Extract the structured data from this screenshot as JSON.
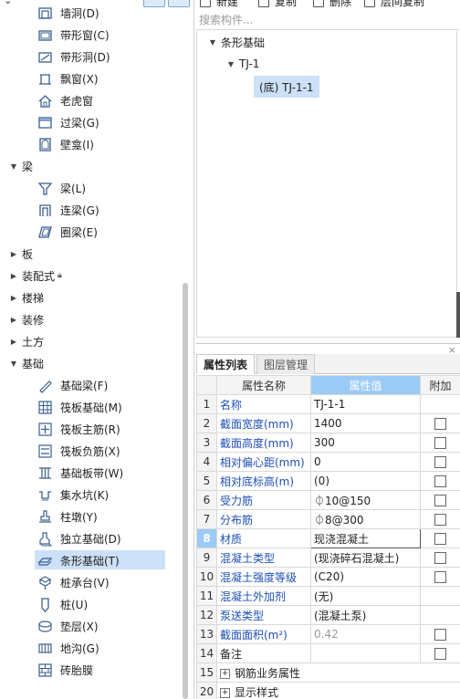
{
  "left_tree": {
    "rows": [
      {
        "type": "item",
        "icon": "wall-opening-icon",
        "label": "墙洞(D)"
      },
      {
        "type": "item",
        "icon": "strip-window-icon",
        "label": "带形窗(C)"
      },
      {
        "type": "item",
        "icon": "strip-opening-icon",
        "label": "带形洞(D)"
      },
      {
        "type": "item",
        "icon": "bay-window-icon",
        "label": "飘窗(X)"
      },
      {
        "type": "item",
        "icon": "dormer-window-icon",
        "label": "老虎窗"
      },
      {
        "type": "item",
        "icon": "lintel-icon",
        "label": "过梁(G)"
      },
      {
        "type": "item",
        "icon": "niche-icon",
        "label": "壁龛(I)"
      },
      {
        "type": "cat",
        "expanded": true,
        "label": "梁"
      },
      {
        "type": "item",
        "icon": "beam-icon",
        "label": "梁(L)"
      },
      {
        "type": "item",
        "icon": "coupling-beam-icon",
        "label": "连梁(G)"
      },
      {
        "type": "item",
        "icon": "ring-beam-icon",
        "label": "圈梁(E)"
      },
      {
        "type": "cat",
        "expanded": false,
        "label": "板"
      },
      {
        "type": "cat",
        "expanded": false,
        "label": "装配式",
        "lock": true
      },
      {
        "type": "cat",
        "expanded": false,
        "label": "楼梯"
      },
      {
        "type": "cat",
        "expanded": false,
        "label": "装修"
      },
      {
        "type": "cat",
        "expanded": false,
        "label": "土方"
      },
      {
        "type": "cat",
        "expanded": true,
        "label": "基础"
      },
      {
        "type": "item",
        "icon": "foundation-beam-icon",
        "label": "基础梁(F)"
      },
      {
        "type": "item",
        "icon": "raft-foundation-icon",
        "label": "筏板基础(M)"
      },
      {
        "type": "item",
        "icon": "raft-main-rebar-icon",
        "label": "筏板主筋(R)"
      },
      {
        "type": "item",
        "icon": "raft-negative-rebar-icon",
        "label": "筏板负筋(X)"
      },
      {
        "type": "item",
        "icon": "foundation-slab-strip-icon",
        "label": "基础板带(W)"
      },
      {
        "type": "item",
        "icon": "sump-pit-icon",
        "label": "集水坑(K)"
      },
      {
        "type": "item",
        "icon": "column-pier-icon",
        "label": "柱墩(Y)"
      },
      {
        "type": "item",
        "icon": "isolated-footing-icon",
        "label": "独立基础(D)"
      },
      {
        "type": "item",
        "icon": "strip-footing-icon",
        "label": "条形基础(T)",
        "selected": true
      },
      {
        "type": "item",
        "icon": "pile-cap-icon",
        "label": "桩承台(V)"
      },
      {
        "type": "item",
        "icon": "pile-icon",
        "label": "桩(U)"
      },
      {
        "type": "item",
        "icon": "cushion-layer-icon",
        "label": "垫层(X)"
      },
      {
        "type": "item",
        "icon": "trench-icon",
        "label": "地沟(G)"
      },
      {
        "type": "item",
        "icon": "brick-mold-icon",
        "label": "砖胎膜"
      }
    ]
  },
  "toolbar": {
    "new_label": "新建",
    "copy_label": "复制",
    "delete_label": "删除",
    "layer_copy_label": "层间复制"
  },
  "search": {
    "placeholder": "搜索构件..."
  },
  "component_tree": {
    "root": "条形基础",
    "child": "TJ-1",
    "leaf": "(底) TJ-1-1"
  },
  "props": {
    "close_glyph": "×",
    "tab_active": "属性列表",
    "tab_inactive": "图层管理",
    "headers": {
      "name": "属性名称",
      "value": "属性值",
      "extra": "附加"
    },
    "rows": [
      {
        "no": "1",
        "name": "名称",
        "value": "TJ-1-1",
        "blue": true,
        "checkbox": false
      },
      {
        "no": "2",
        "name": "截面宽度(mm)",
        "value": "1400",
        "blue": true,
        "checkbox": true
      },
      {
        "no": "3",
        "name": "截面高度(mm)",
        "value": "300",
        "blue": true,
        "checkbox": true
      },
      {
        "no": "4",
        "name": "相对偏心距(mm)",
        "value": "0",
        "blue": true,
        "checkbox": true
      },
      {
        "no": "5",
        "name": "相对底标高(m)",
        "value": "(0)",
        "blue": true,
        "checkbox": true
      },
      {
        "no": "6",
        "name": "受力筋",
        "value": "⏀10@150",
        "blue": true,
        "checkbox": true
      },
      {
        "no": "7",
        "name": "分布筋",
        "value": "⏀8@300",
        "blue": true,
        "checkbox": true
      },
      {
        "no": "8",
        "name": "材质",
        "value": "现浇混凝土",
        "blue": true,
        "checkbox": true,
        "highlight": true
      },
      {
        "no": "9",
        "name": "混凝土类型",
        "value": "(现浇碎石混凝土)",
        "blue": true,
        "checkbox": true
      },
      {
        "no": "10",
        "name": "混凝土强度等级",
        "value": "(C20)",
        "blue": true,
        "checkbox": true
      },
      {
        "no": "11",
        "name": "混凝土外加剂",
        "value": "(无)",
        "blue": true,
        "checkbox": false
      },
      {
        "no": "12",
        "name": "泵送类型",
        "value": "(混凝土泵)",
        "blue": true,
        "checkbox": false
      },
      {
        "no": "13",
        "name": "截面面积(m²)",
        "value": "0.42",
        "blue": true,
        "checkbox": true,
        "gray": true
      },
      {
        "no": "14",
        "name": "备注",
        "value": "",
        "blue": false,
        "checkbox": true
      },
      {
        "no": "15",
        "name": "钢筋业务属性",
        "value": "",
        "blue": false,
        "checkbox": false,
        "expander": true
      },
      {
        "no": "20",
        "name": "显示样式",
        "value": "",
        "blue": false,
        "checkbox": false,
        "expander": true
      }
    ]
  },
  "colors": {
    "selection": "#cce0f7",
    "header_highlight": "#9ccbf5",
    "blue_text": "#1f4fb4"
  }
}
